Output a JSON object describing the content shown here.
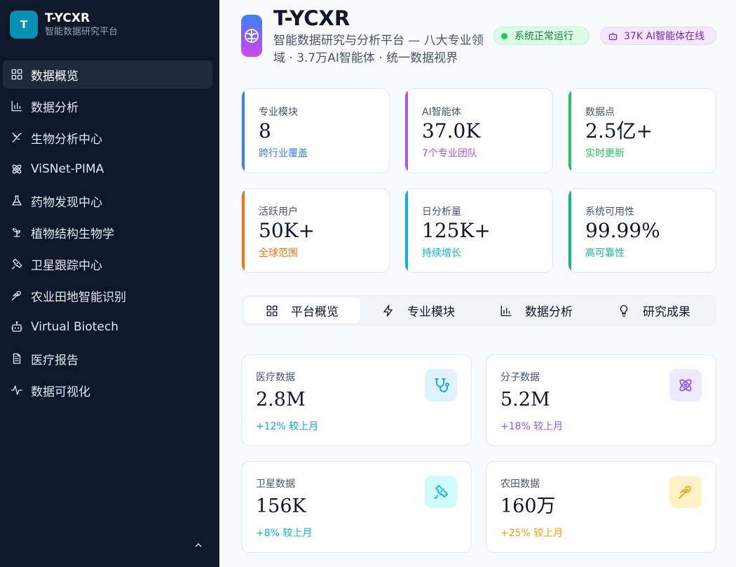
{
  "brand": {
    "logo_letter": "T",
    "name": "T-YCXR",
    "subtitle": "智能数据研究平台"
  },
  "sidebar": {
    "items": [
      {
        "label": "数据概览",
        "icon": "grid-icon",
        "active": true
      },
      {
        "label": "数据分析",
        "icon": "bar-chart-icon"
      },
      {
        "label": "生物分析中心",
        "icon": "dna-icon"
      },
      {
        "label": "ViSNet-PIMA",
        "icon": "atom-icon"
      },
      {
        "label": "药物发现中心",
        "icon": "flask-icon"
      },
      {
        "label": "植物结构生物学",
        "icon": "sprout-icon"
      },
      {
        "label": "卫星跟踪中心",
        "icon": "satellite-icon"
      },
      {
        "label": "农业田地智能识别",
        "icon": "wheat-icon"
      },
      {
        "label": "Virtual Biotech",
        "icon": "bot-icon"
      },
      {
        "label": "医疗报告",
        "icon": "document-icon"
      },
      {
        "label": "数据可视化",
        "icon": "activity-icon"
      }
    ]
  },
  "header": {
    "title": "T-YCXR",
    "subtitle": "智能数据研究与分析平台 — 八大专业领域 · 3.7万AI智能体 · 统一数据视界",
    "status_badge": "系统正常运行",
    "ai_badge": "37K AI智能体在线"
  },
  "stats": [
    {
      "label": "专业模块",
      "value": "8",
      "note": "跨行业覆盖",
      "color": "#3b82f6"
    },
    {
      "label": "AI智能体",
      "value": "37.0K",
      "note": "7个专业团队",
      "color": "#a855f7"
    },
    {
      "label": "数据点",
      "value": "2.5亿+",
      "note": "实时更新",
      "color": "#22c55e"
    },
    {
      "label": "活跃用户",
      "value": "50K+",
      "note": "全球范围",
      "color": "#f97316"
    },
    {
      "label": "日分析量",
      "value": "125K+",
      "note": "持续增长",
      "color": "#06b6d4"
    },
    {
      "label": "系统可用性",
      "value": "99.99%",
      "note": "高可靠性",
      "color": "#10b981"
    }
  ],
  "tabs": [
    {
      "label": "平台概览",
      "icon": "grid-icon",
      "active": true
    },
    {
      "label": "专业模块",
      "icon": "lightning-icon"
    },
    {
      "label": "数据分析",
      "icon": "bar-chart-icon"
    },
    {
      "label": "研究成果",
      "icon": "lightbulb-icon"
    }
  ],
  "data_cards": [
    {
      "label": "医疗数据",
      "value": "2.8M",
      "change": "+12% 较上月",
      "icon": "stethoscope-icon",
      "color": "#0ea5e9",
      "bg": "#e0f2fe"
    },
    {
      "label": "分子数据",
      "value": "5.2M",
      "change": "+18% 较上月",
      "icon": "atom-icon",
      "color": "#8b5cf6",
      "bg": "#ede9fe"
    },
    {
      "label": "卫星数据",
      "value": "156K",
      "change": "+8% 较上月",
      "icon": "satellite-icon",
      "color": "#06b6d4",
      "bg": "#cffafe"
    },
    {
      "label": "农田数据",
      "value": "160万",
      "change": "+25% 较上月",
      "icon": "wheat-icon",
      "color": "#f59e0b",
      "bg": "#fef3c7"
    }
  ]
}
